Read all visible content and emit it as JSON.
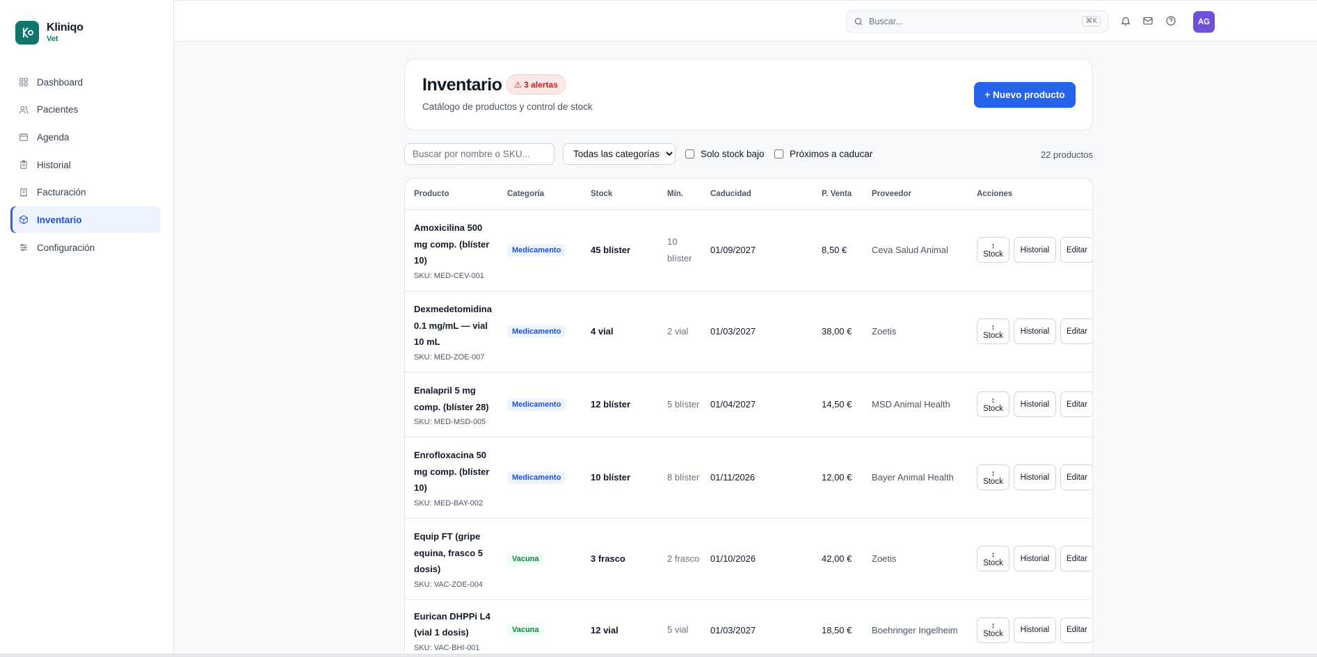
{
  "brand": {
    "name": "Kliniqo",
    "sub": "Vet"
  },
  "sidebar": {
    "items": [
      {
        "label": "Dashboard",
        "icon": "grid-icon"
      },
      {
        "label": "Pacientes",
        "icon": "users-icon"
      },
      {
        "label": "Agenda",
        "icon": "calendar-icon"
      },
      {
        "label": "Historial",
        "icon": "clipboard-icon"
      },
      {
        "label": "Facturación",
        "icon": "receipt-icon"
      },
      {
        "label": "Inventario",
        "icon": "box-icon",
        "active": true
      },
      {
        "label": "Configuración",
        "icon": "sliders-icon"
      }
    ]
  },
  "header": {
    "search_placeholder": "Buscar...",
    "search_shortcut": "⌘K",
    "avatar_initials": "AG"
  },
  "page": {
    "title": "Inventario",
    "alert_badge": "⚠ 3 alertas",
    "subtitle": "Catálogo de productos y control de stock",
    "new_button": "+ Nuevo producto"
  },
  "filters": {
    "search_placeholder": "Buscar por nombre o SKU...",
    "category_selected": "Todas las categorías",
    "low_stock_label": "Solo stock bajo",
    "expiring_label": "Próximos a caducar",
    "count": "22 productos"
  },
  "table": {
    "columns": [
      "Producto",
      "Categoría",
      "Stock",
      "Mín.",
      "Caducidad",
      "P. Venta",
      "Proveedor",
      "Acciones"
    ],
    "action_labels": {
      "stock": "Stock",
      "stock_arrow": "↕",
      "history": "Historial",
      "edit": "Editar"
    },
    "rows": [
      {
        "name": "Amoxicilina 500 mg comp. (blíster 10)",
        "sku": "SKU: MED-CEV-001",
        "category": "Medicamento",
        "stock": "45 blíster",
        "min": "10 blíster",
        "expiry": "01/09/2027",
        "price": "8,50 €",
        "supplier": "Ceva Salud Animal"
      },
      {
        "name": "Dexmedetomidina 0.1 mg/mL — vial 10 mL",
        "sku": "SKU: MED-ZOE-007",
        "category": "Medicamento",
        "stock": "4 vial",
        "min": "2 vial",
        "expiry": "01/03/2027",
        "price": "38,00 €",
        "supplier": "Zoetis"
      },
      {
        "name": "Enalapril 5 mg comp. (blíster 28)",
        "sku": "SKU: MED-MSD-005",
        "category": "Medicamento",
        "stock": "12 blíster",
        "min": "5 blíster",
        "expiry": "01/04/2027",
        "price": "14,50 €",
        "supplier": "MSD Animal Health"
      },
      {
        "name": "Enrofloxacina 50 mg comp. (blíster 10)",
        "sku": "SKU: MED-BAY-002",
        "category": "Medicamento",
        "stock": "10 blíster",
        "min": "8 blíster",
        "expiry": "01/11/2026",
        "price": "12,00 €",
        "supplier": "Bayer Animal Health"
      },
      {
        "name": "Equip FT (gripe equina, frasco 5 dosis)",
        "sku": "SKU: VAC-ZOE-004",
        "category": "Vacuna",
        "stock": "3 frasco",
        "min": "2 frasco",
        "expiry": "01/10/2026",
        "price": "42,00 €",
        "supplier": "Zoetis"
      },
      {
        "name": "Eurican DHPPi L4 (vial 1 dosis)",
        "sku": "SKU: VAC-BHI-001",
        "category": "Vacuna",
        "stock": "12 vial",
        "min": "5 vial",
        "expiry": "01/03/2027",
        "price": "18,50 €",
        "supplier": "Boehringer Ingelheim"
      }
    ]
  },
  "colors": {
    "accent": "#2563eb",
    "brand": "#0f766e",
    "alert": "#c81e1e",
    "avatar": "#6d4fd8"
  }
}
